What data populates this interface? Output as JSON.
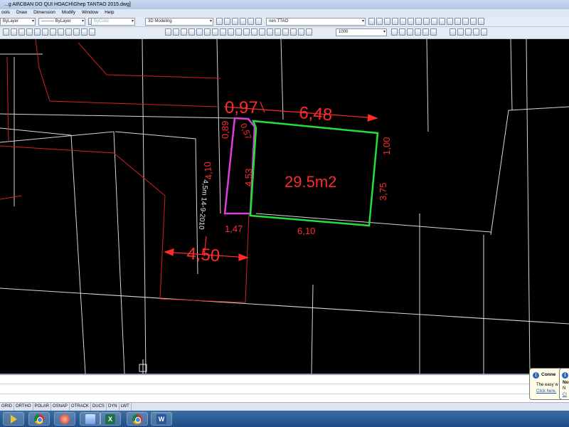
{
  "window": {
    "title": "...g A8\\CBAN DO QUI HOACH\\Ghep TANTAO 2015.dwg]"
  },
  "menu": [
    "ools",
    "Draw",
    "Dimension",
    "Modify",
    "Window",
    "Help"
  ],
  "toolbar": {
    "layer_combo": "ByLayer",
    "linetype_combo": "ByLayer",
    "color_combo": "ByColor",
    "workspace_combo": "3D Modeling",
    "layer_name_combo": "nen TTAO",
    "scale_combo": "1000"
  },
  "drawing": {
    "area_label": "29.5m2",
    "dimensions": {
      "top_left": "0,97",
      "top": "6,48",
      "right_top": "1,00",
      "right": "3,75",
      "bottom": "6,10",
      "bottom_left": "1,47",
      "left_top": "0,89",
      "diagonal": "0,57",
      "inner_left": "4,53",
      "left_side": "4,10",
      "road_width": "4,50"
    },
    "annotation": "4,5m 14-9-2010",
    "colors": {
      "dim_text": "#ff2b2b",
      "plot_outline": "#22e03a",
      "strip_outline": "#e23ce0",
      "grid": "#d8d8d8",
      "boundary": "#d42020"
    }
  },
  "status": {
    "toggles": [
      "GRID",
      "ORTHO",
      "POLAR",
      "OSNAP",
      "OTRACK",
      "DUCS",
      "DYN",
      "LWT"
    ]
  },
  "taskbar": {
    "apps": [
      "media-player",
      "chrome",
      "app-red",
      "app-blue",
      "excel",
      "chrome",
      "word"
    ],
    "excel_letter": "X",
    "word_letter": "W"
  },
  "notifications": [
    {
      "title": "Conne",
      "body": "The easy w",
      "link": "Click here."
    },
    {
      "title": "No",
      "body": "N",
      "link": "Cl"
    }
  ]
}
